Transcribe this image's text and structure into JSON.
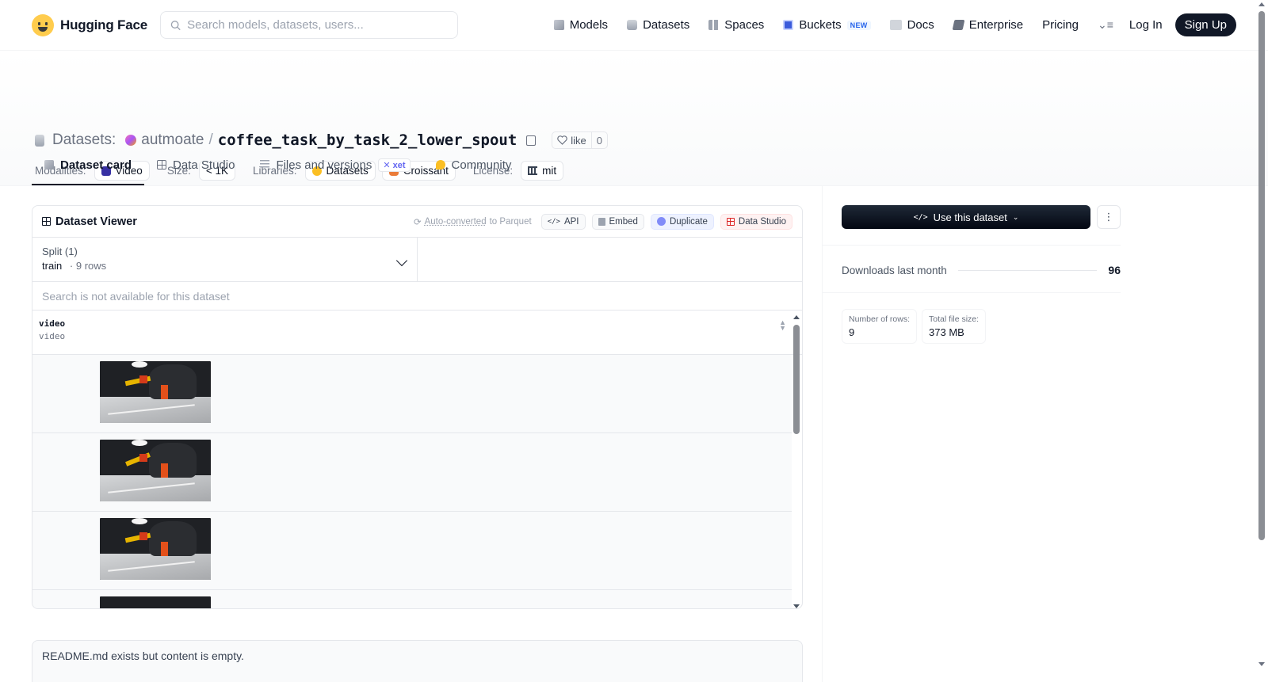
{
  "header": {
    "logo_text": "Hugging Face",
    "search_placeholder": "Search models, datasets, users...",
    "nav": [
      {
        "label": "Models",
        "icon": "cube-icon"
      },
      {
        "label": "Datasets",
        "icon": "database-icon"
      },
      {
        "label": "Spaces",
        "icon": "grid-icon"
      },
      {
        "label": "Buckets",
        "icon": "bucket-icon",
        "badge": "NEW"
      },
      {
        "label": "Docs",
        "icon": "book-icon"
      },
      {
        "label": "Enterprise",
        "icon": "enterprise-icon"
      },
      {
        "label": "Pricing"
      }
    ],
    "login": "Log In",
    "signup": "Sign Up"
  },
  "dataset": {
    "kind_label": "Datasets:",
    "org": "autmoate",
    "slash": "/",
    "name": "coffee_task_by_task_2_lower_spout",
    "like_label": "like",
    "like_count": "0",
    "meta": {
      "modalities_label": "Modalities:",
      "modality": "Video",
      "size_label": "Size:",
      "size": "< 1K",
      "libraries_label": "Libraries:",
      "libraries": [
        "Datasets",
        "Croissant"
      ],
      "license_label": "License:",
      "license": "mit"
    }
  },
  "tabs": [
    {
      "label": "Dataset card",
      "active": true
    },
    {
      "label": "Data Studio"
    },
    {
      "label": "Files and versions",
      "badge": "xet"
    },
    {
      "label": "Community"
    }
  ],
  "viewer": {
    "title": "Dataset Viewer",
    "auto_converted_link": "Auto-converted",
    "auto_converted_rest": "to Parquet",
    "buttons": {
      "api": "API",
      "embed": "Embed",
      "duplicate": "Duplicate",
      "studio": "Data Studio"
    },
    "split_label": "Split (1)",
    "split_value": "train",
    "split_rows": "9 rows",
    "search_na": "Search is not available for this dataset",
    "column": {
      "name": "video",
      "type": "video"
    },
    "visible_rows": 4
  },
  "readme_text": "README.md exists but content is empty.",
  "sidebar": {
    "use_button": "Use this dataset",
    "downloads_label": "Downloads last month",
    "downloads_value": "96",
    "stats": [
      {
        "label": "Number of rows:",
        "value": "9"
      },
      {
        "label": "Total file size:",
        "value": "373 MB"
      }
    ]
  }
}
